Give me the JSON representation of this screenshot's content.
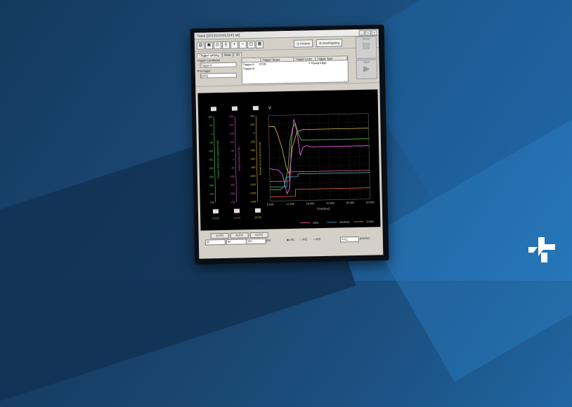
{
  "window": {
    "title": "Trace [20131124113143.ok]"
  },
  "toolbar": {
    "history_label": "History",
    "overlapping_label": "Overlapping",
    "setup_label": "Setup",
    "start_label": "Start"
  },
  "tabs": [
    "Trigger setting",
    "Data",
    "I/O"
  ],
  "trigger": {
    "conditions_label": "Trigger Conditions",
    "condition_value": "Trigger A",
    "pretrigger_label": "Pre-trigger",
    "pretrigger_value": "[50%]",
    "headers": [
      "",
      "Trigger Target",
      "Trigger Level",
      "Trigger Type"
    ],
    "rows": [
      {
        "name": "Trigger A",
        "target": "/CON",
        "level": "",
        "type": "Rising Edge"
      },
      {
        "name": "Trigger B",
        "target": "",
        "level": "",
        "type": ""
      }
    ]
  },
  "scope": {
    "y_label": "V",
    "axes": [
      {
        "color": "#55dd55",
        "ticks": [
          "100",
          "50",
          "0",
          "-50",
          "-100",
          "-150",
          "-200",
          "-250",
          "-300",
          "-350",
          "-400"
        ],
        "label": "Position Reference Speed [mm/s]",
        "unit": "[CH1]"
      },
      {
        "color": "#d060d0",
        "ticks": [
          "250",
          "200",
          "150",
          "100",
          "50",
          "0",
          "-50",
          "-100",
          "-150",
          "-200",
          "-250"
        ],
        "label": "Torque Reference [%]",
        "unit": "[CH2]"
      },
      {
        "color": "#d8c030",
        "ticks": [
          "400",
          "200",
          "0",
          "-200",
          "-400",
          "-600",
          "-800",
          "-1000",
          "-1200",
          "-1400",
          "-1600"
        ],
        "label": "Position Error [reference unit]",
        "unit": "[CH3]"
      }
    ],
    "x_ticks": [
      "0.000",
      "12.500",
      "25.000",
      "37.500",
      "50.000",
      "62.500"
    ],
    "x_label": "Time[ms]",
    "legend": [
      "DEN",
      "INSPOS",
      "/COIN"
    ]
  },
  "bottom": {
    "auto_labels": [
      "AUTO",
      "AUTO",
      "AUTO"
    ],
    "selects": [
      "50",
      "50",
      "200"
    ],
    "unit_box": "[div]",
    "radio_options": [
      "#01",
      "#02",
      "#03"
    ],
    "zoom_value": "FULL",
    "ms_unit": "[ms/div]"
  },
  "colors": {
    "background": "#1a4670",
    "scope": "#000000"
  },
  "icons": [
    "open-icon",
    "save-icon",
    "print-icon",
    "cursor-icon",
    "zoom-in-icon",
    "zoom-out-icon",
    "history-icon",
    "overlap-icon"
  ]
}
